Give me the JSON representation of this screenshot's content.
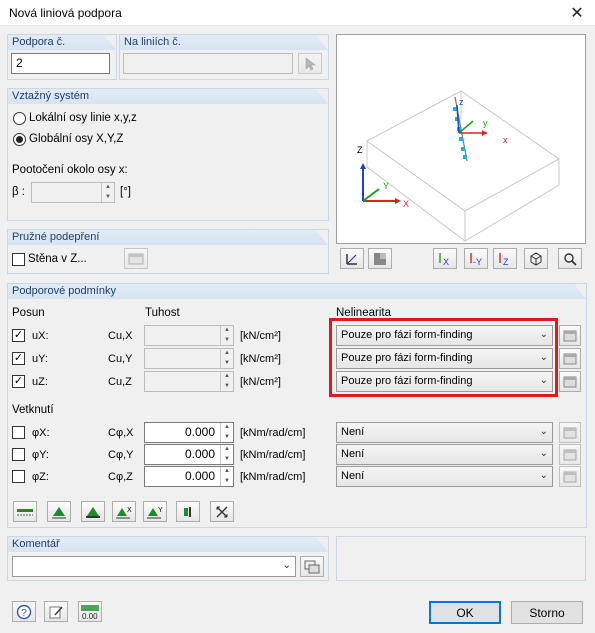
{
  "window": {
    "title": "Nová liniová podpora",
    "close_glyph": "✕"
  },
  "support_no": {
    "label": "Podpora č.",
    "value": "2"
  },
  "on_lines": {
    "label": "Na liniích č.",
    "value": ""
  },
  "coord_system": {
    "label": "Vztažný systém",
    "options": [
      "Lokální osy linie x,y,z",
      "Globální osy X,Y,Z"
    ],
    "selected_index": 1,
    "rotation_label": "Pootočení okolo osy x:",
    "beta_label": "β :",
    "beta_value": "",
    "beta_unit": "[°]"
  },
  "elastic": {
    "label": "Pružné podepření",
    "wall_label": "Stěna v Z..."
  },
  "conditions": {
    "label": "Podporové podmínky",
    "col_posun": "Posun",
    "col_tuhost": "Tuhost",
    "col_nelinearita": "Nelinearita",
    "translation_rows": [
      {
        "axis": "uX:",
        "sym": "Cu,X",
        "value": "",
        "unit": "[kN/cm²]",
        "checked": true,
        "nonlin": "Pouze pro fázi form-finding"
      },
      {
        "axis": "uY:",
        "sym": "Cu,Y",
        "value": "",
        "unit": "[kN/cm²]",
        "checked": true,
        "nonlin": "Pouze pro fázi form-finding"
      },
      {
        "axis": "uZ:",
        "sym": "Cu,Z",
        "value": "",
        "unit": "[kN/cm²]",
        "checked": true,
        "nonlin": "Pouze pro fázi form-finding"
      }
    ],
    "fixity_label": "Vetknutí",
    "rotation_rows": [
      {
        "axis": "φX:",
        "sym": "Cφ,X",
        "value": "0.000",
        "unit": "[kNm/rad/cm]",
        "checked": false,
        "nonlin": "Není"
      },
      {
        "axis": "φY:",
        "sym": "Cφ,Y",
        "value": "0.000",
        "unit": "[kNm/rad/cm]",
        "checked": false,
        "nonlin": "Není"
      },
      {
        "axis": "φZ:",
        "sym": "Cφ,Z",
        "value": "0.000",
        "unit": "[kNm/rad/cm]",
        "checked": false,
        "nonlin": "Není"
      }
    ]
  },
  "comment": {
    "label": "Komentář",
    "value": ""
  },
  "buttons": {
    "ok": "OK",
    "cancel": "Storno"
  },
  "preview": {
    "axis_x": "X",
    "axis_y": "Y",
    "axis_z": "Z",
    "local_x": "x",
    "local_y": "y",
    "local_z": "z"
  },
  "colors": {
    "highlight": "#e01b1b",
    "accent": "#0078d7",
    "axis_x": "#e02020",
    "axis_y": "#1aa01a",
    "axis_z": "#1f3fd0"
  }
}
